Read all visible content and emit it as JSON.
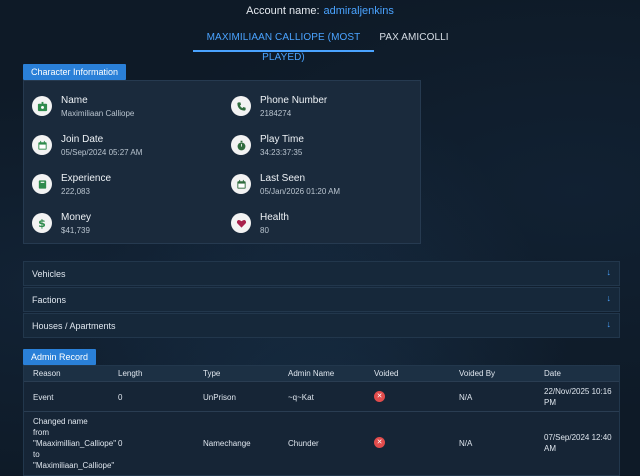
{
  "account": {
    "label": "Account name:",
    "name": "admiraljenkins"
  },
  "tabs": [
    {
      "label": "MAXIMILIAAN CALLIOPE (MOST PLAYED)"
    },
    {
      "label": "PAX AMICOLLI"
    }
  ],
  "character": {
    "header": "Character Information",
    "items": [
      {
        "label": "Name",
        "value": "Maximiliaan Calliope",
        "icon": "id-card-icon"
      },
      {
        "label": "Phone Number",
        "value": "2184274",
        "icon": "phone-icon"
      },
      {
        "label": "Join Date",
        "value": "05/Sep/2024 05:27 AM",
        "icon": "calendar-icon"
      },
      {
        "label": "Play Time",
        "value": "34:23:37:35",
        "icon": "stopwatch-icon"
      },
      {
        "label": "Experience",
        "value": "222,083",
        "icon": "book-icon"
      },
      {
        "label": "Last Seen",
        "value": "05/Jan/2026 01:20 AM",
        "icon": "calendar-icon"
      },
      {
        "label": "Money",
        "value": "$41,739",
        "icon": "dollar-icon"
      },
      {
        "label": "Health",
        "value": "80",
        "icon": "heart-icon"
      }
    ]
  },
  "accordions": [
    {
      "label": "Vehicles"
    },
    {
      "label": "Factions"
    },
    {
      "label": "Houses / Apartments"
    }
  ],
  "admin": {
    "header": "Admin Record",
    "columns": [
      "Reason",
      "Length",
      "Type",
      "Admin Name",
      "Voided",
      "Voided By",
      "Date"
    ],
    "rows": [
      {
        "reason": [
          "Event"
        ],
        "length": "0",
        "type": "UnPrison",
        "admin": "~q~Kat",
        "voided_by": "N/A",
        "date": [
          "22/Nov/2025 10:16",
          "PM"
        ]
      },
      {
        "reason": [
          "Changed name",
          "from",
          "\"Maaximillian_Calliope\"",
          "to",
          "\"Maximiliaan_Calliope\""
        ],
        "length": "0",
        "type": "Namechange",
        "admin": "Chunder",
        "voided_by": "N/A",
        "date": [
          "07/Sep/2024 12:40",
          "AM"
        ]
      }
    ]
  },
  "colors": {
    "accent": "#4aa3ff",
    "header_bg": "#2a80d8",
    "voided": "#e24c4c"
  }
}
